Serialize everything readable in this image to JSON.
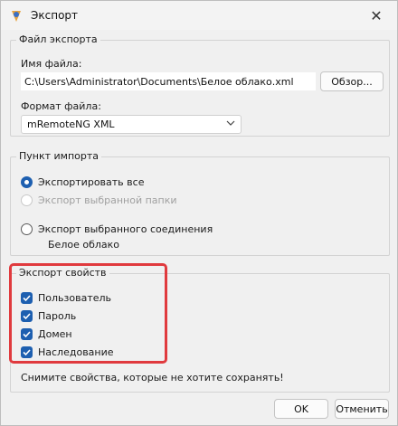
{
  "window": {
    "title": "Экспорт",
    "close_glyph": "✕"
  },
  "export_file": {
    "legend": "Файл экспорта",
    "filename_label": "Имя файла:",
    "filename_value": "C:\\Users\\Administrator\\Documents\\Белое облако.xml",
    "browse_label": "Обзор...",
    "format_label": "Формат файла:",
    "format_value": "mRemoteNG XML"
  },
  "import_point": {
    "legend": "Пункт импорта",
    "options": [
      {
        "label": "Экспортировать все",
        "checked": true,
        "enabled": true
      },
      {
        "label": "Экспорт выбранной папки",
        "checked": false,
        "enabled": false
      },
      {
        "label": "Экспорт выбранного соединения",
        "checked": false,
        "enabled": true
      }
    ],
    "selected_connection": "Белое облако"
  },
  "export_properties": {
    "legend": "Экспорт свойств",
    "items": [
      {
        "label": "Пользователь",
        "checked": true
      },
      {
        "label": "Пароль",
        "checked": true
      },
      {
        "label": "Домен",
        "checked": true
      },
      {
        "label": "Наследование",
        "checked": true
      }
    ],
    "hint": "Снимите свойства, которые не хотите сохранять!"
  },
  "buttons": {
    "ok": "OK",
    "cancel": "Отменить"
  },
  "colors": {
    "accent": "#1d5fb0",
    "highlight": "#e03a3e"
  }
}
